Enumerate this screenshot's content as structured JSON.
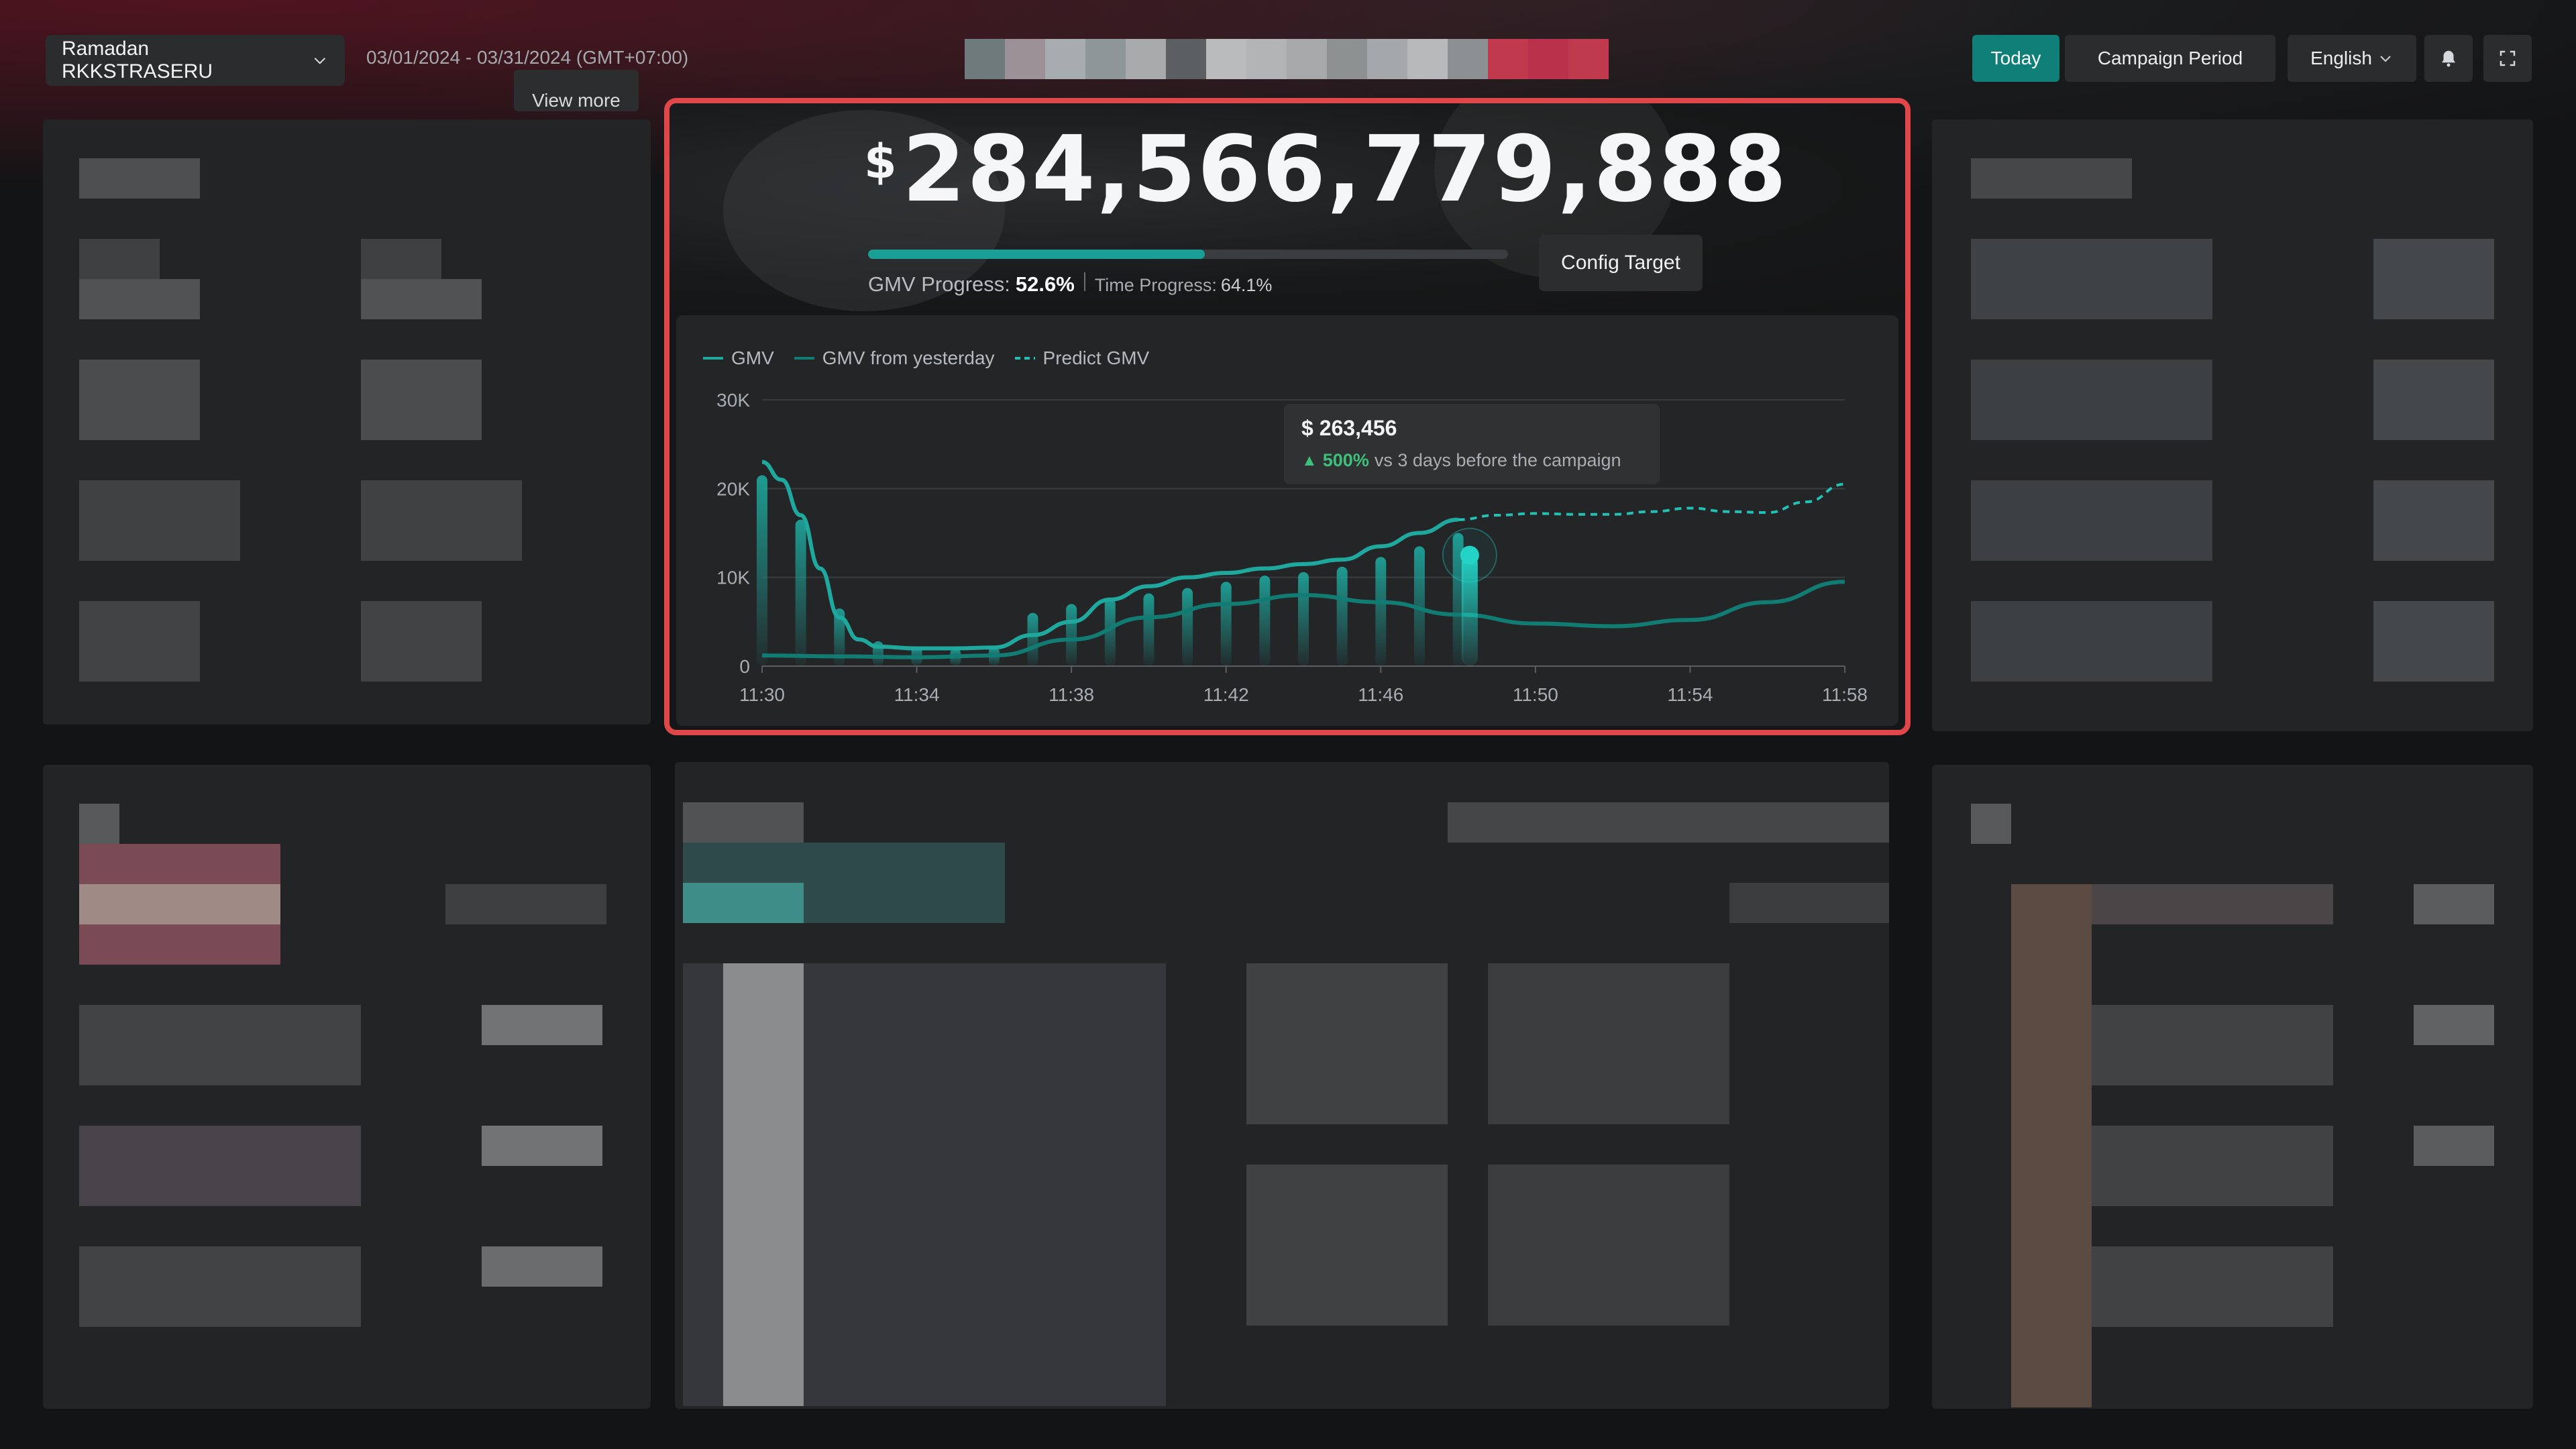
{
  "header": {
    "campaign_name": "Ramadan RKKSTRASERU",
    "date_range": "03/01/2024 - 03/31/2024 (GMT+07:00)",
    "view_more": "View more",
    "today_label": "Today",
    "campaign_period_label": "Campaign Period",
    "language_label": "English",
    "icons": [
      "chevron-down-icon",
      "bell-icon",
      "fullscreen-icon"
    ]
  },
  "summary": {
    "currency_symbol": "$",
    "gmv_amount": "284,566,779,888",
    "gmv_progress_label": "GMV Progress:",
    "gmv_progress_value": "52.6%",
    "gmv_progress_fraction": 0.526,
    "time_progress_label": "Time Progress:",
    "time_progress_value": "64.1%",
    "config_target_label": "Config Target"
  },
  "tooltip": {
    "value": "$ 263,456",
    "change_pct": "500%",
    "change_text": "vs 3 days before the campaign"
  },
  "colors": {
    "accent": "#0f7f78",
    "gmv_line": "#1ea89e",
    "yesterday_line": "#117c73",
    "predict_line": "#22c1b6",
    "highlight_border": "#e0474a",
    "positive": "#3cc07a"
  },
  "chart_data": {
    "type": "line",
    "legend": [
      "GMV",
      "GMV from yesterday",
      "Predict GMV"
    ],
    "x_ticks": [
      "11:30",
      "11:34",
      "11:38",
      "11:42",
      "11:46",
      "11:50",
      "11:54",
      "11:58"
    ],
    "y_ticks": [
      "0",
      "10K",
      "20K",
      "30K"
    ],
    "ylim": [
      0,
      30000
    ],
    "xlim": [
      0,
      28
    ],
    "grid": true,
    "legend_position": "top-left",
    "series": [
      {
        "name": "GMV",
        "x": [
          0,
          0.5,
          1,
          1.5,
          2,
          2.5,
          3,
          4,
          5,
          6,
          7,
          8,
          9,
          10,
          11,
          12,
          13,
          14,
          15,
          16,
          17,
          18
        ],
        "values": [
          23000,
          21000,
          17000,
          11000,
          5500,
          3000,
          2200,
          2000,
          2000,
          2100,
          3500,
          5000,
          7500,
          9000,
          10000,
          10500,
          11000,
          11500,
          12000,
          13500,
          15000,
          16500
        ]
      },
      {
        "name": "GMV from yesterday",
        "x": [
          0,
          2,
          4,
          6,
          8,
          10,
          12,
          14,
          16,
          18,
          20,
          22,
          24,
          26,
          28
        ],
        "values": [
          1200,
          1100,
          1000,
          1200,
          3000,
          5500,
          7000,
          8000,
          7200,
          5800,
          4800,
          4500,
          5200,
          7200,
          9500
        ]
      },
      {
        "name": "Predict GMV",
        "x": [
          18,
          19,
          20,
          21,
          22,
          23,
          24,
          25,
          26,
          27,
          28
        ],
        "values": [
          16500,
          17000,
          17200,
          17100,
          17100,
          17400,
          17800,
          17400,
          17300,
          18500,
          20500
        ]
      },
      {
        "name": "GMV bars",
        "x": [
          0,
          1,
          2,
          3,
          4,
          5,
          6,
          7,
          8,
          9,
          10,
          11,
          12,
          13,
          14,
          15,
          16,
          17,
          18
        ],
        "values": [
          21500,
          16500,
          6500,
          2800,
          2200,
          2000,
          2200,
          6000,
          7000,
          7600,
          8200,
          8800,
          9500,
          10200,
          10600,
          11200,
          12300,
          13500,
          15000
        ]
      }
    ],
    "highlight": {
      "x": 18.3,
      "value": 12500
    }
  }
}
